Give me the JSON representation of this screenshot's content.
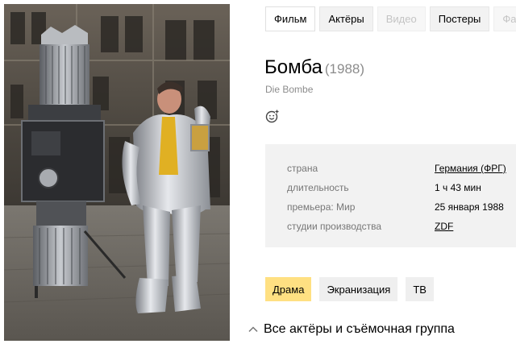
{
  "tabs": [
    {
      "label": "Фильм",
      "state": "active"
    },
    {
      "label": "Актёры",
      "state": "normal"
    },
    {
      "label": "Видео",
      "state": "disabled"
    },
    {
      "label": "Постеры",
      "state": "normal"
    },
    {
      "label": "Факт",
      "state": "disabled"
    }
  ],
  "movie": {
    "title": "Бомба",
    "year": "(1988)",
    "original_title": "Die Bombe",
    "reaction_icon": "smile-plus-icon"
  },
  "info": [
    {
      "key": "страна",
      "value": "Германия (ФРГ)",
      "link": true
    },
    {
      "key": "длительность",
      "value": "1 ч 43 мин",
      "link": false
    },
    {
      "key": "премьера: Мир",
      "value": "25 января 1988",
      "link": false
    },
    {
      "key": "студии производства",
      "value": "ZDF",
      "link": true
    }
  ],
  "genres": [
    {
      "label": "Драма",
      "highlight": true
    },
    {
      "label": "Экранизация",
      "highlight": false
    },
    {
      "label": "ТВ",
      "highlight": false
    }
  ],
  "cast_toggle": {
    "label": "Все актёры и съёмочная группа",
    "icon": "chevron-up-icon"
  },
  "colors": {
    "genre_highlight": "#ffe082",
    "panel_bg": "#f2f2f2",
    "muted_text": "#8c8c8c"
  }
}
